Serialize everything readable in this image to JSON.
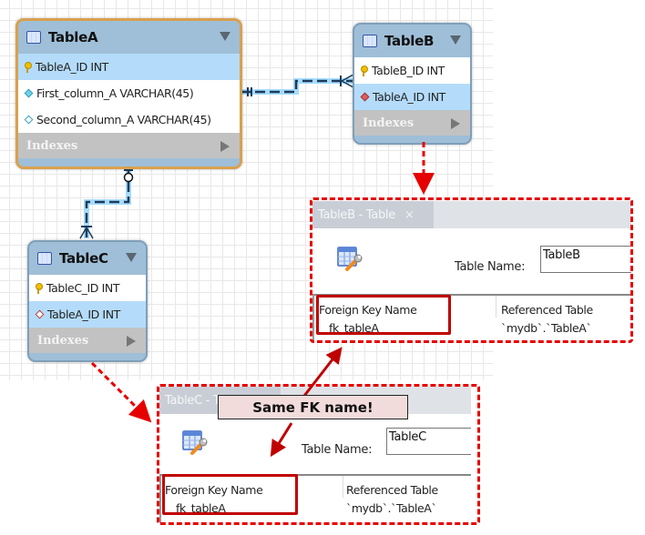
{
  "diagram": {
    "entities": [
      {
        "name": "TableA",
        "selected": true,
        "columns": [
          {
            "label": "TableA_ID INT",
            "icon": "primary-key-icon",
            "highlighted": true
          },
          {
            "label": "First_column_A VARCHAR(45)",
            "icon": "not-null-column-icon",
            "highlighted": false
          },
          {
            "label": "Second_column_A VARCHAR(45)",
            "icon": "nullable-column-icon",
            "highlighted": false
          }
        ],
        "indexes_label": "Indexes"
      },
      {
        "name": "TableB",
        "selected": false,
        "columns": [
          {
            "label": "TableB_ID INT",
            "icon": "primary-key-icon",
            "highlighted": false
          },
          {
            "label": "TableA_ID INT",
            "icon": "foreign-key-column-icon",
            "highlighted": true
          }
        ],
        "indexes_label": "Indexes"
      },
      {
        "name": "TableC",
        "selected": false,
        "columns": [
          {
            "label": "TableC_ID INT",
            "icon": "primary-key-icon",
            "highlighted": false
          },
          {
            "label": "TableA_ID INT",
            "icon": "foreign-key-nullable-column-icon",
            "highlighted": true
          }
        ],
        "indexes_label": "Indexes"
      }
    ],
    "relationships": [
      {
        "from": "TableA",
        "to": "TableB",
        "type": "one-to-many identifying"
      },
      {
        "from": "TableA",
        "to": "TableC",
        "type": "zero-or-one-to-many"
      }
    ]
  },
  "panels": [
    {
      "tab_label": "TableB - Table",
      "tab_close": "×",
      "table_name_label": "Table Name:",
      "table_name_value": "TableB",
      "fk_columns": [
        "Foreign Key Name",
        "Referenced Table"
      ],
      "fk_rows": [
        [
          "fk_tableA",
          "`mydb`.`TableA`"
        ]
      ]
    },
    {
      "tab_label": "TableC - Table",
      "tab_close": "×",
      "table_name_label": "Table Name:",
      "table_name_value": "TableC",
      "fk_columns": [
        "Foreign Key Name",
        "Referenced Table"
      ],
      "fk_rows": [
        [
          "fk_tableA",
          "`mydb`.`TableA`"
        ]
      ]
    }
  ],
  "annotation": {
    "callout_text": "Same FK name!",
    "highlight_color": "#c00000",
    "dash_color": "#e60000",
    "callout_bg": "#f2dcdb"
  }
}
